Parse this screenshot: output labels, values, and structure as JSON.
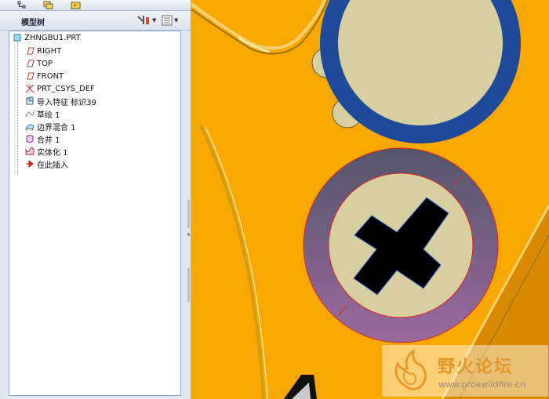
{
  "panel": {
    "title": "模型树",
    "tabs": [
      "model-tree-tab",
      "layer-tab",
      "favorites-tab"
    ]
  },
  "tree": {
    "root": "ZHNGBU1.PRT",
    "items": [
      {
        "label": "RIGHT",
        "icon": "datum-plane-icon"
      },
      {
        "label": "TOP",
        "icon": "datum-plane-icon"
      },
      {
        "label": "FRONT",
        "icon": "datum-plane-icon"
      },
      {
        "label": "PRT_CSYS_DEF",
        "icon": "csys-icon"
      },
      {
        "label": "导入特征 标识39",
        "icon": "import-feature-icon"
      },
      {
        "label": "草绘 1",
        "icon": "sketch-icon"
      },
      {
        "label": "边界混合 1",
        "icon": "boundary-blend-icon"
      },
      {
        "label": "合并 1",
        "icon": "merge-icon"
      },
      {
        "label": "实体化 1",
        "icon": "solidify-icon"
      },
      {
        "label": "在此插入",
        "icon": "insert-here-icon"
      }
    ]
  },
  "watermark": {
    "title": "野火论坛",
    "url": "www.proewildfire.cn"
  },
  "colors": {
    "viewport_bg": "#f8a800",
    "blue_ring": "#1f4a9a",
    "purple_ring": "#7a5a8c",
    "face": "#d8cfa0",
    "cross": "#000000"
  }
}
